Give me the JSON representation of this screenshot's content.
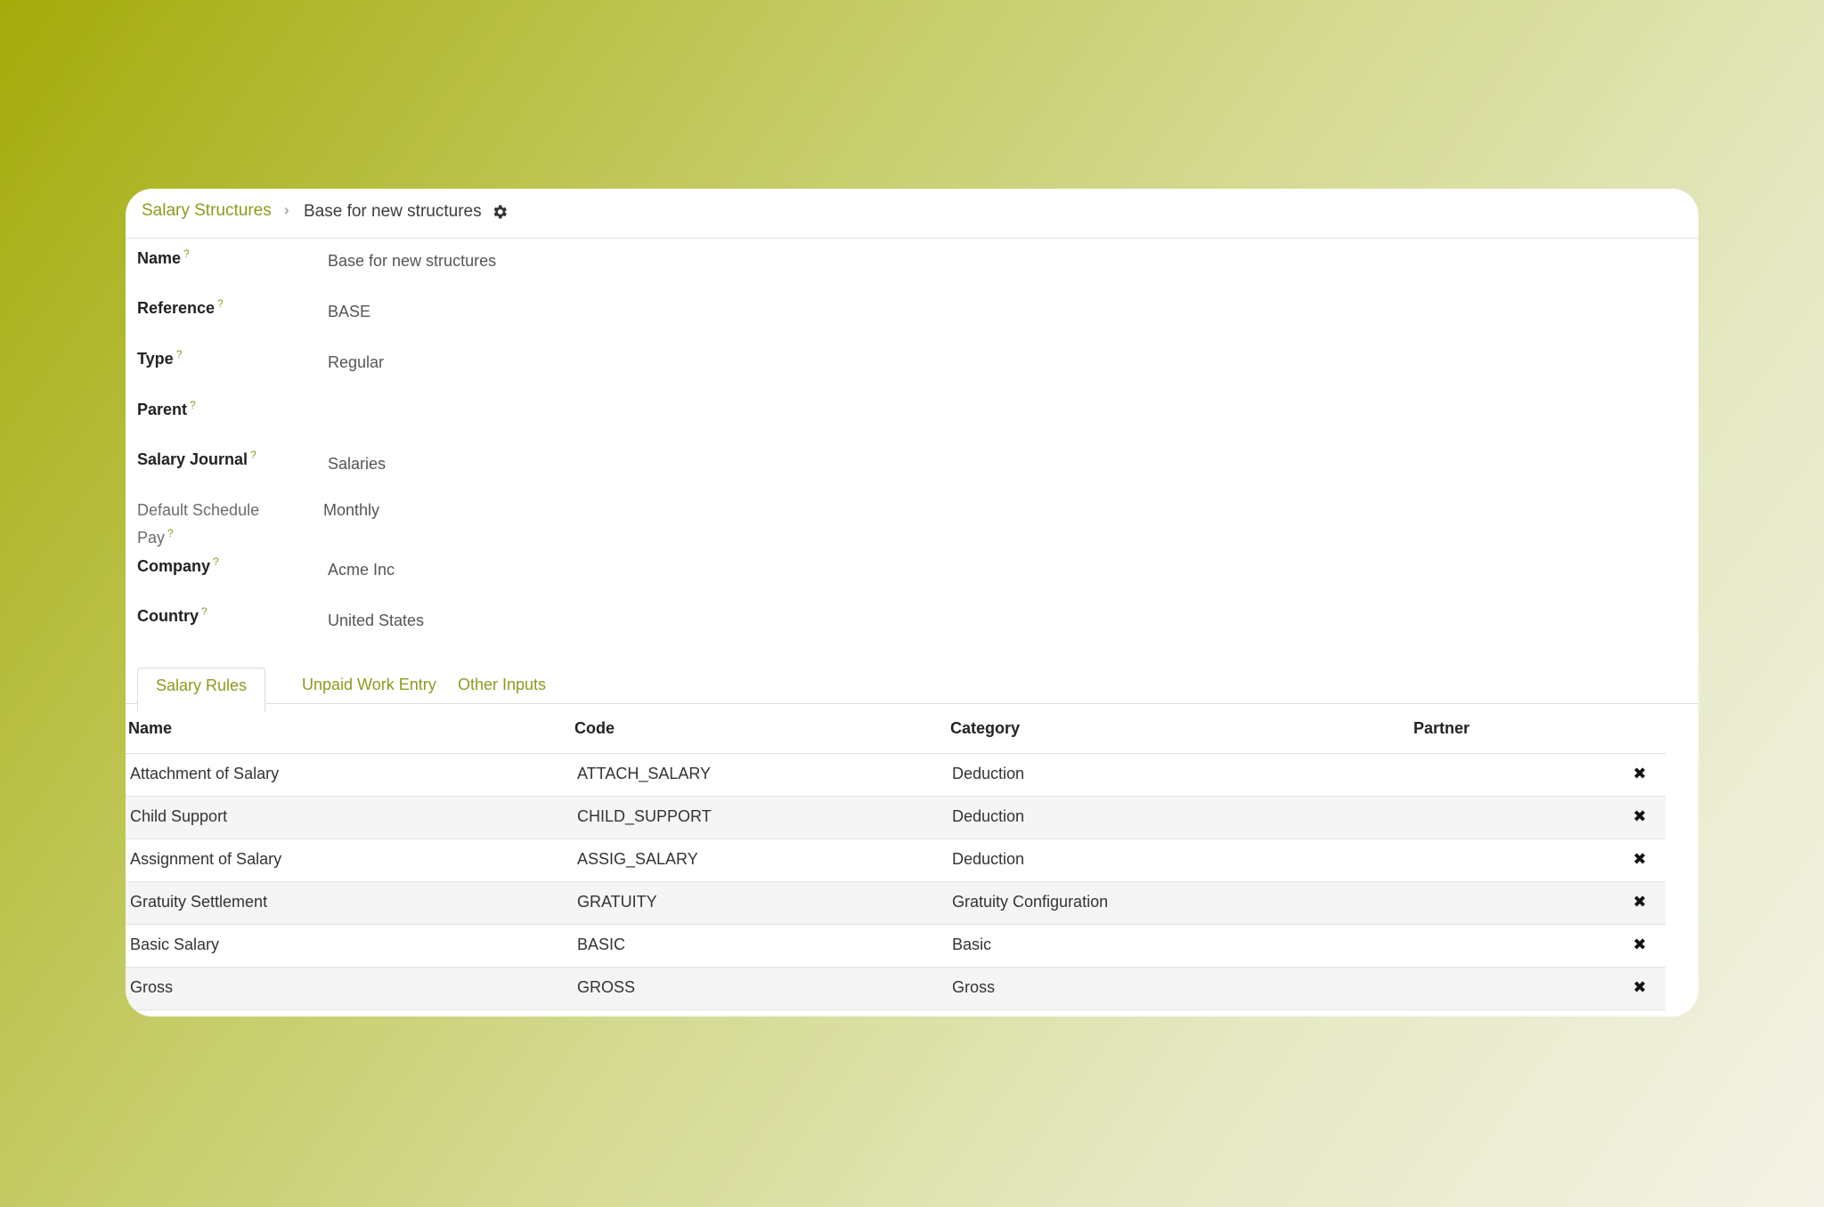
{
  "breadcrumb": {
    "parent": "Salary Structures",
    "separator": "›",
    "current": "Base for new structures",
    "action_icon": "gear-icon"
  },
  "fields": [
    {
      "label": "Name",
      "help": "?",
      "value": "Base for new structures"
    },
    {
      "label": "Reference",
      "help": "?",
      "value": "BASE"
    },
    {
      "label": "Type",
      "help": "?",
      "value": "Regular"
    },
    {
      "label": "Parent",
      "help": "?",
      "value": ""
    },
    {
      "label": "Salary Journal",
      "help": "?",
      "value": "Salaries"
    },
    {
      "label": "Default Schedule Pay",
      "help": "?",
      "value": "Monthly"
    },
    {
      "label": "Company",
      "help": "?",
      "value": "Acme Inc"
    },
    {
      "label": "Country",
      "help": "?",
      "value": "United States"
    }
  ],
  "tabs": [
    {
      "label": "Salary Rules",
      "active": true
    },
    {
      "label": "Unpaid Work Entry",
      "active": false
    },
    {
      "label": "Other Inputs",
      "active": false
    }
  ],
  "table": {
    "columns": [
      "Name",
      "Code",
      "Category",
      "Partner"
    ],
    "rows": [
      {
        "name": "Attachment of Salary",
        "code": "ATTACH_SALARY",
        "category": "Deduction",
        "partner": ""
      },
      {
        "name": "Child Support",
        "code": "CHILD_SUPPORT",
        "category": "Deduction",
        "partner": ""
      },
      {
        "name": "Assignment of Salary",
        "code": "ASSIG_SALARY",
        "category": "Deduction",
        "partner": ""
      },
      {
        "name": "Gratuity Settlement",
        "code": "GRATUITY",
        "category": "Gratuity Configuration",
        "partner": ""
      },
      {
        "name": "Basic Salary",
        "code": "BASIC",
        "category": "Basic",
        "partner": ""
      },
      {
        "name": "Gross",
        "code": "GROSS",
        "category": "Gross",
        "partner": ""
      }
    ],
    "delete_icon": "✖"
  },
  "colors": {
    "accent": "#8e9a1d",
    "row_alt": "#f5f5f5"
  }
}
